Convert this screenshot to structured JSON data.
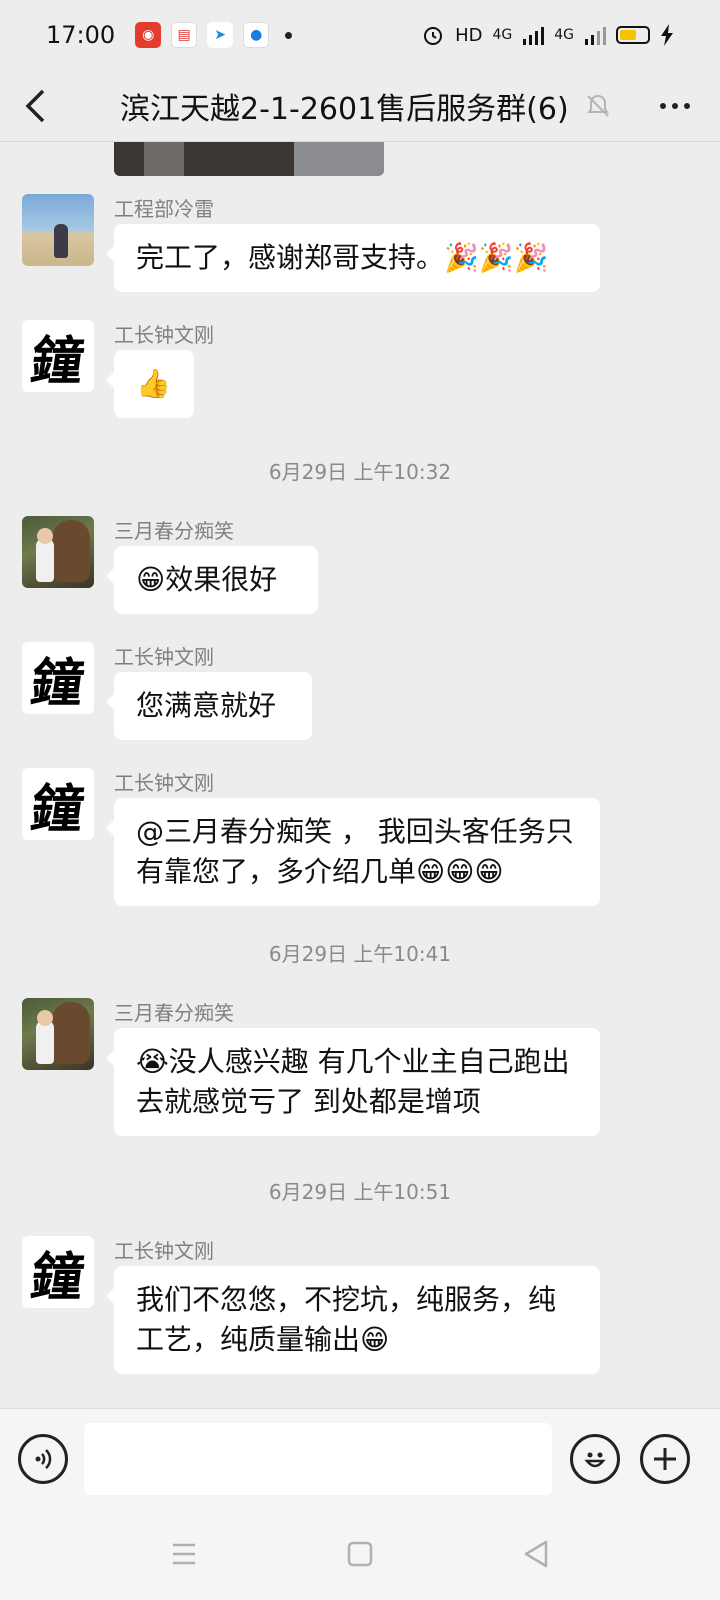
{
  "status_bar": {
    "time": "17:00",
    "hd_label": "HD",
    "net1": "4G",
    "net2": "4G",
    "app_icons": [
      "news-app-icon",
      "calendar-app-icon",
      "send-app-icon",
      "browser-app-icon"
    ]
  },
  "nav": {
    "title": "滨江天越2-1-2601售后服务群(6)"
  },
  "messages": [
    {
      "sender": "工程部冷雷",
      "text": "完工了，感谢郑哥支持。🎉🎉🎉"
    },
    {
      "sender": "工长钟文刚",
      "text": "👍"
    },
    {
      "sender": "三月春分痴笑",
      "text": "😁效果很好"
    },
    {
      "sender": "工长钟文刚",
      "text": "您满意就好"
    },
    {
      "sender": "工长钟文刚",
      "text": "@三月春分痴笑 ， 我回头客任务只有靠您了，多介绍几单😁😁😁"
    },
    {
      "sender": "三月春分痴笑",
      "text": "😭没人感兴趣 有几个业主自己跑出去就感觉亏了 到处都是增项"
    },
    {
      "sender": "工长钟文刚",
      "text": "我们不忽悠，不挖坑，纯服务，纯工艺，纯质量输出😁"
    }
  ],
  "timestamps": [
    "6月29日 上午10:32",
    "6月29日 上午10:41",
    "6月29日 上午10:51"
  ],
  "avatar_glyph": "鐘",
  "input": {
    "placeholder": ""
  },
  "colors": {
    "background": "#ededed",
    "bubble": "#ffffff",
    "battery": "#f5c400"
  }
}
